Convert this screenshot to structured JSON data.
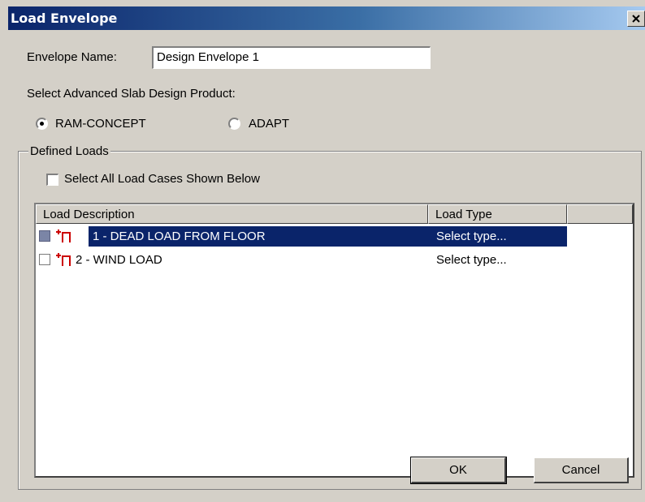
{
  "window": {
    "title": "Load Envelope"
  },
  "envelope": {
    "label": "Envelope Name:",
    "value": "Design Envelope 1"
  },
  "product": {
    "label": "Select Advanced Slab Design Product:",
    "options": [
      {
        "label": "RAM-CONCEPT",
        "selected": true
      },
      {
        "label": "ADAPT",
        "selected": false
      }
    ]
  },
  "defined_loads": {
    "group_title": "Defined Loads",
    "select_all_label": "Select All Load Cases Shown Below",
    "columns": [
      "Load Description",
      "Load Type"
    ],
    "rows": [
      {
        "description": "1 - DEAD LOAD FROM FLOOR",
        "type": "Select type...",
        "selected": true,
        "checked": false
      },
      {
        "description": "2 - WIND LOAD",
        "type": "Select type...",
        "selected": false,
        "checked": false
      }
    ]
  },
  "buttons": {
    "ok": "OK",
    "cancel": "Cancel"
  },
  "colors": {
    "title_gradient_start": "#0a246a",
    "title_gradient_end": "#a6caf0",
    "selection": "#0a246a",
    "face": "#d4d0c8",
    "load_icon": "#cc0000"
  }
}
